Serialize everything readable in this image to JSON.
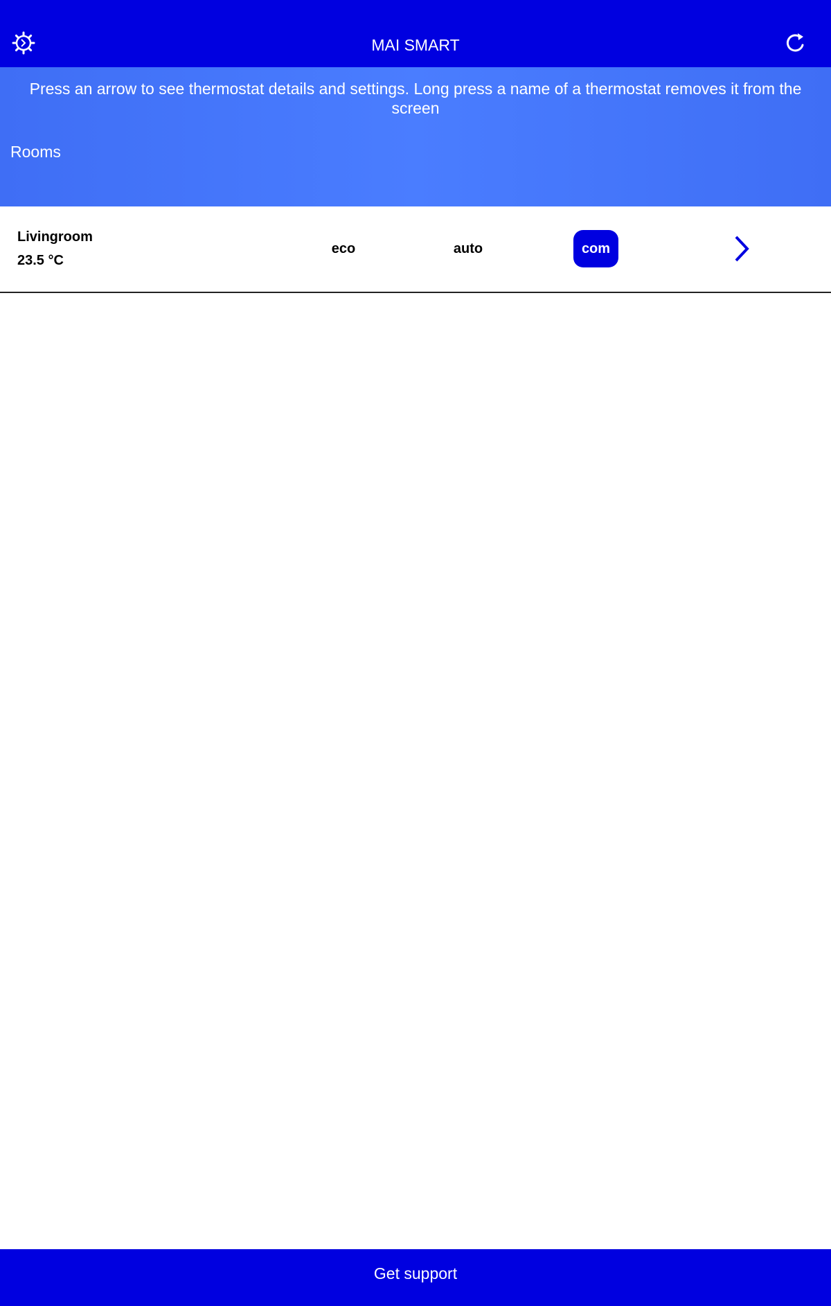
{
  "header": {
    "title": "MAI SMART",
    "left_icon": "gear-icon",
    "right_icon": "refresh-icon"
  },
  "banner": {
    "hint": "Press an arrow to see thermostat details and settings. Long press a name of a thermostat removes it from the screen",
    "section_label": "Rooms"
  },
  "rooms": [
    {
      "name": "Livingroom",
      "temperature": "23.5 °C",
      "modes": [
        "eco",
        "auto",
        "com"
      ],
      "selected_mode": "com",
      "details_icon": "chevron-right-icon"
    }
  ],
  "footer": {
    "label": "Get support"
  },
  "colors": {
    "primary": "#0000e0",
    "banner": "#4a7dff",
    "text_on_primary": "#ffffff"
  }
}
